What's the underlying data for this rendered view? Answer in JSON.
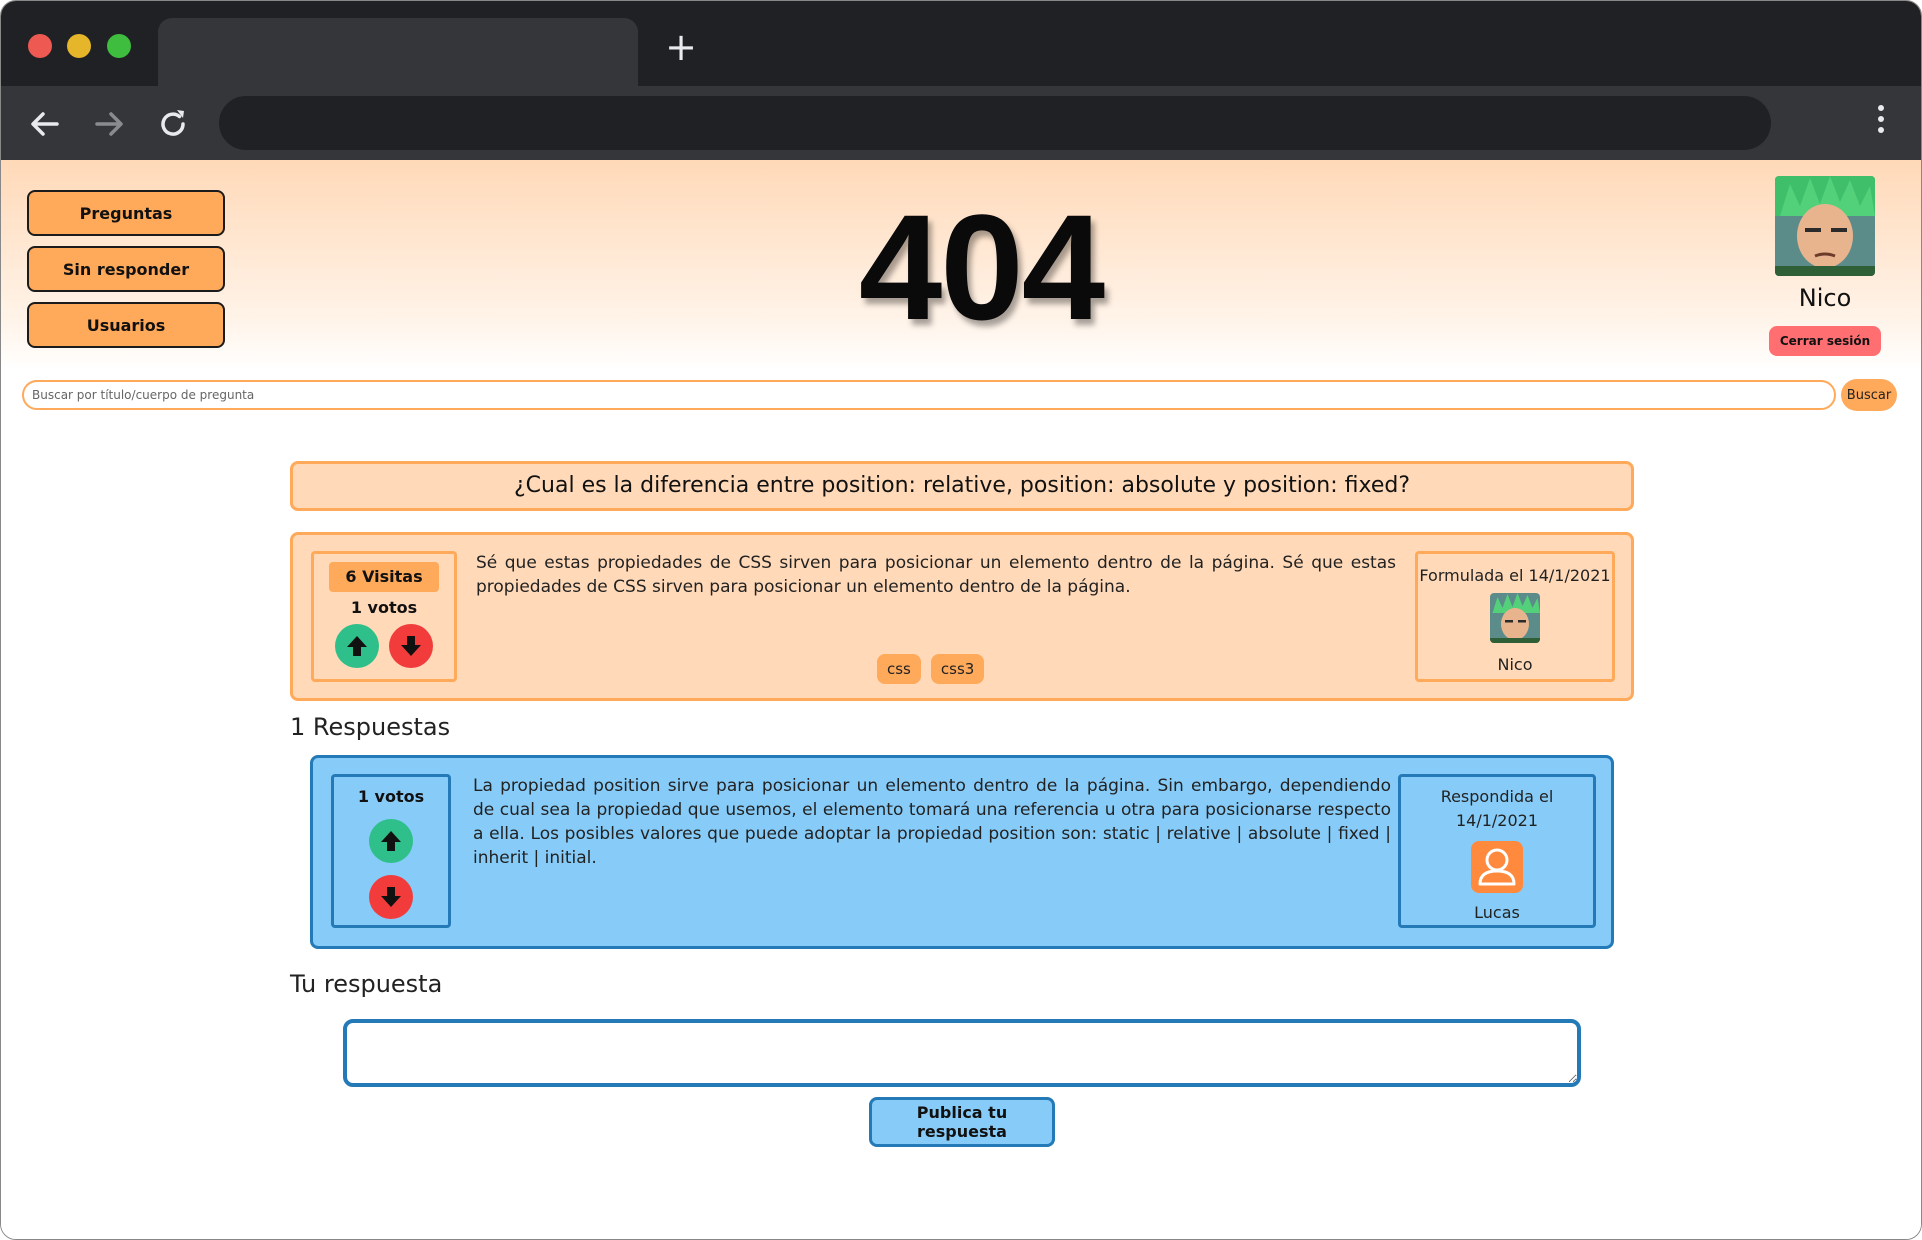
{
  "browser": {
    "new_tab_symbol": "+",
    "url": ""
  },
  "nav": {
    "items": [
      {
        "label": "Preguntas"
      },
      {
        "label": "Sin responder"
      },
      {
        "label": "Usuarios"
      }
    ]
  },
  "header": {
    "big_title": "404"
  },
  "user": {
    "name": "Nico",
    "logout_label": "Cerrar sesión"
  },
  "search": {
    "placeholder": "Buscar por título/cuerpo de pregunta",
    "value": "",
    "button_label": "Buscar"
  },
  "question": {
    "title": "¿Cual es la diferencia entre position: relative, position: absolute y position: fixed?",
    "visits_label": "6 Visitas",
    "votes_label": "1 votos",
    "body": "Sé que estas propiedades de CSS sirven para posicionar un elemento dentro de la página. Sé que estas propiedades de CSS sirven para posicionar un elemento dentro de la página.",
    "tags": [
      "css",
      "css3"
    ],
    "asked_label": "Formulada el 14/1/2021",
    "author": "Nico"
  },
  "answers": {
    "count_label": "1 Respuestas",
    "items": [
      {
        "votes_label": "1 votos",
        "body": "La propiedad position sirve para posicionar un elemento dentro de la página. Sin embargo, dependiendo de cual sea la propiedad que usemos, el elemento tomará una referencia u otra para posicionarse respecto a ella. Los posibles valores que puede adoptar la propiedad position son: static | relative | absolute | fixed | inherit | initial.",
        "answered_label": "Respondida el 14/1/2021",
        "author": "Lucas"
      }
    ]
  },
  "reply": {
    "heading": "Tu respuesta",
    "value": "",
    "button_label": "Publica tu respuesta"
  },
  "colors": {
    "accent_orange": "#ffa95a",
    "question_bg": "#ffd9b8",
    "answer_bg": "#87ccf8",
    "answer_border": "#2479b7",
    "upvote": "#2fbf8a",
    "downvote": "#f23c3c",
    "logout": "#ff6f72"
  }
}
